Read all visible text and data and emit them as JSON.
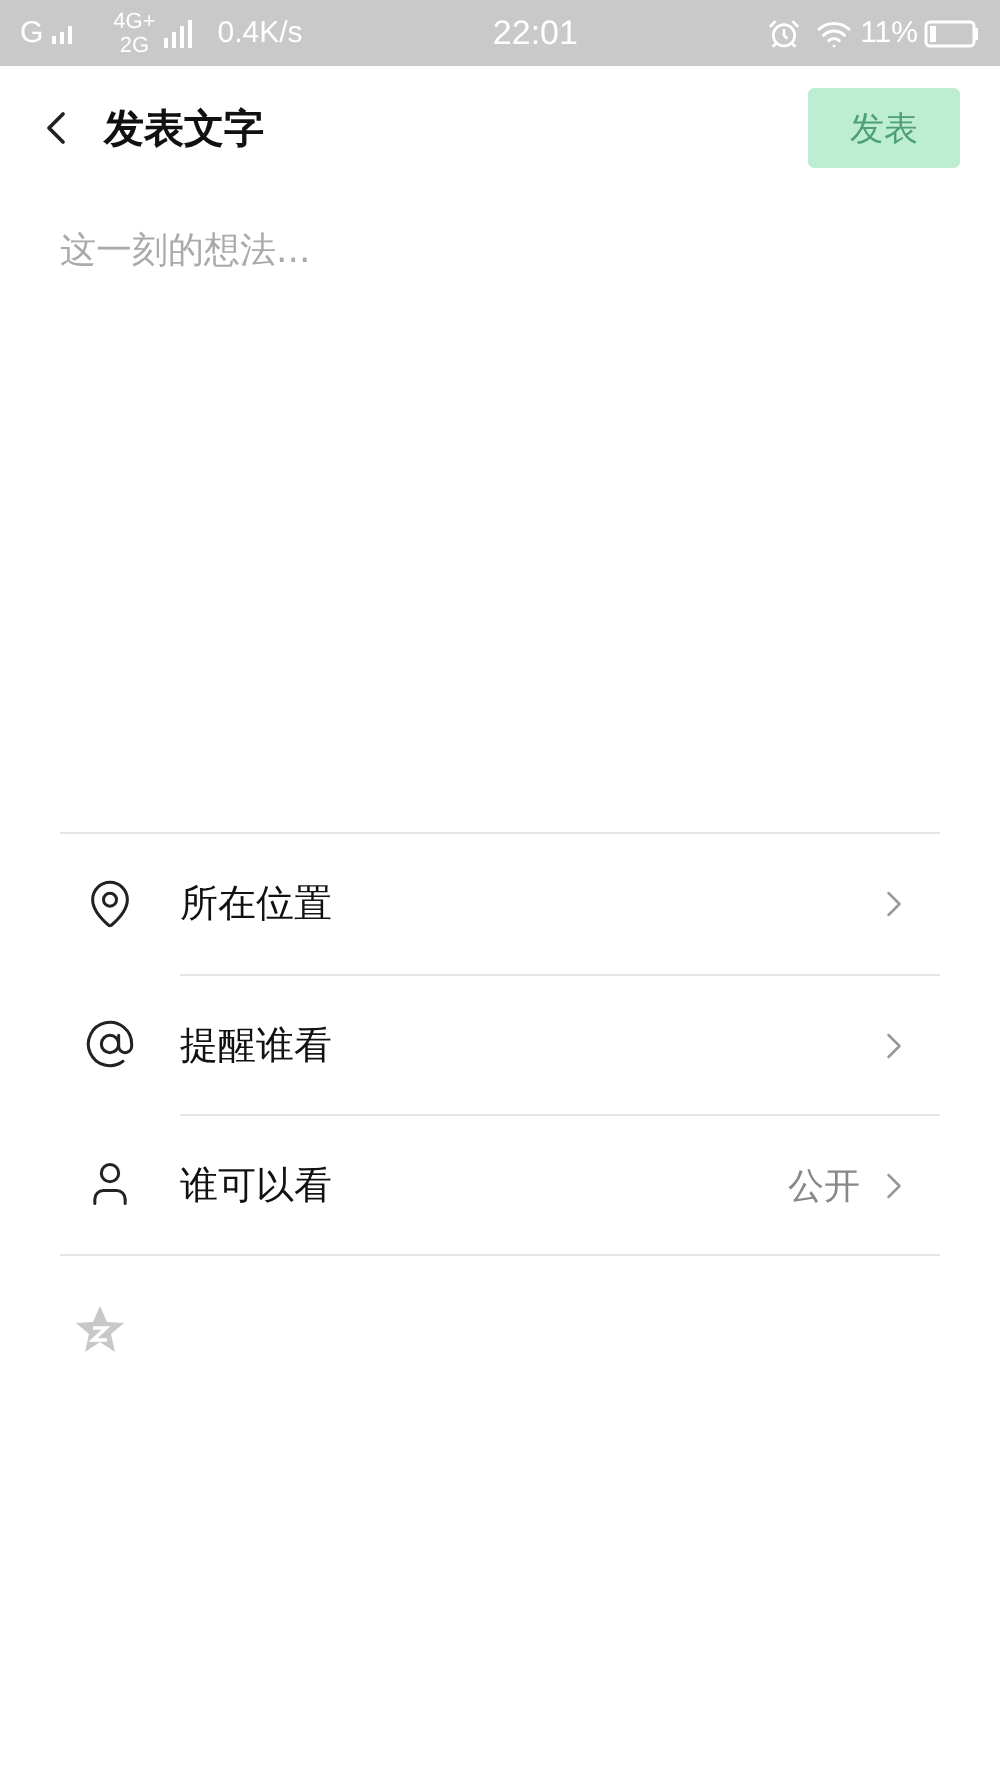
{
  "status_bar": {
    "sim1": "G",
    "sim2_top": "4G+",
    "sim2_bottom": "2G",
    "speed": "0.4K/s",
    "time": "22:01",
    "battery": "11%"
  },
  "header": {
    "title": "发表文字",
    "publish": {
      "label": "发表",
      "disabled": true
    }
  },
  "compose": {
    "placeholder": "这一刻的想法..."
  },
  "options": [
    {
      "kind": "location",
      "label": "所在位置"
    },
    {
      "kind": "mention",
      "label": "提醒谁看"
    },
    {
      "kind": "visibility",
      "label": "谁可以看",
      "value": "公开"
    }
  ]
}
